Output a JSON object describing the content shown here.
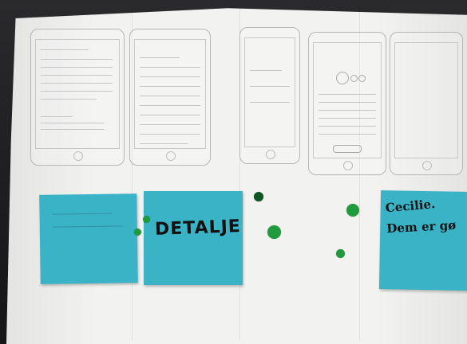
{
  "photo": {
    "notes": [
      {
        "id": "note-left",
        "text": "",
        "color": "#3bb3c7"
      },
      {
        "id": "note-detalje",
        "text": "DETALJE",
        "color": "#3bb3c7"
      },
      {
        "id": "note-right",
        "line1": "Cecilie.",
        "line2": "Dem er gø",
        "color": "#3bb3c7"
      }
    ],
    "dot_color": "#1f9a3c",
    "ink_color": "#111111",
    "sticky_color": "#3bb3c7"
  }
}
